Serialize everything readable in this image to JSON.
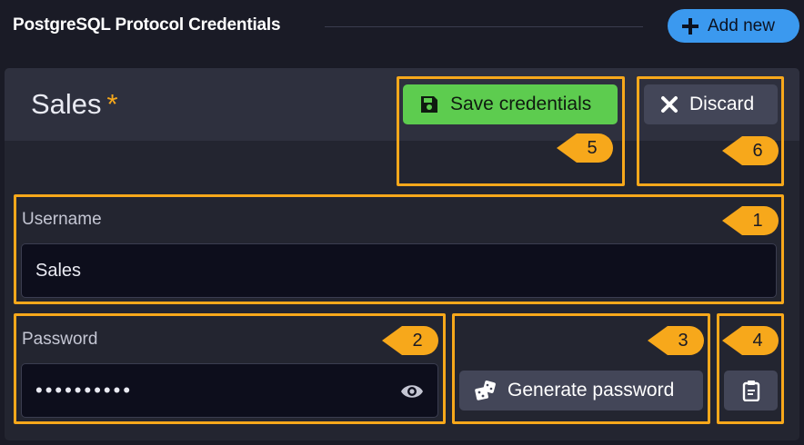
{
  "header": {
    "title": "PostgreSQL Protocol Credentials",
    "add_new_label": "Add new"
  },
  "credential": {
    "name": "Sales",
    "unsaved_marker": "*"
  },
  "actions": {
    "save_label": "Save credentials",
    "discard_label": "Discard",
    "generate_label": "Generate password"
  },
  "fields": {
    "username": {
      "label": "Username",
      "value": "Sales"
    },
    "password": {
      "label": "Password",
      "masked_value": "••••••••••"
    }
  },
  "annotations": {
    "c1": "1",
    "c2": "2",
    "c3": "3",
    "c4": "4",
    "c5": "5",
    "c6": "6"
  },
  "colors": {
    "accent": "#3b99ef",
    "save": "#5dcc4f",
    "highlight": "#f7a81b"
  },
  "icons": [
    "plus-icon",
    "floppy-disk-icon",
    "close-icon",
    "dice-icon",
    "clipboard-icon",
    "eye-icon"
  ]
}
